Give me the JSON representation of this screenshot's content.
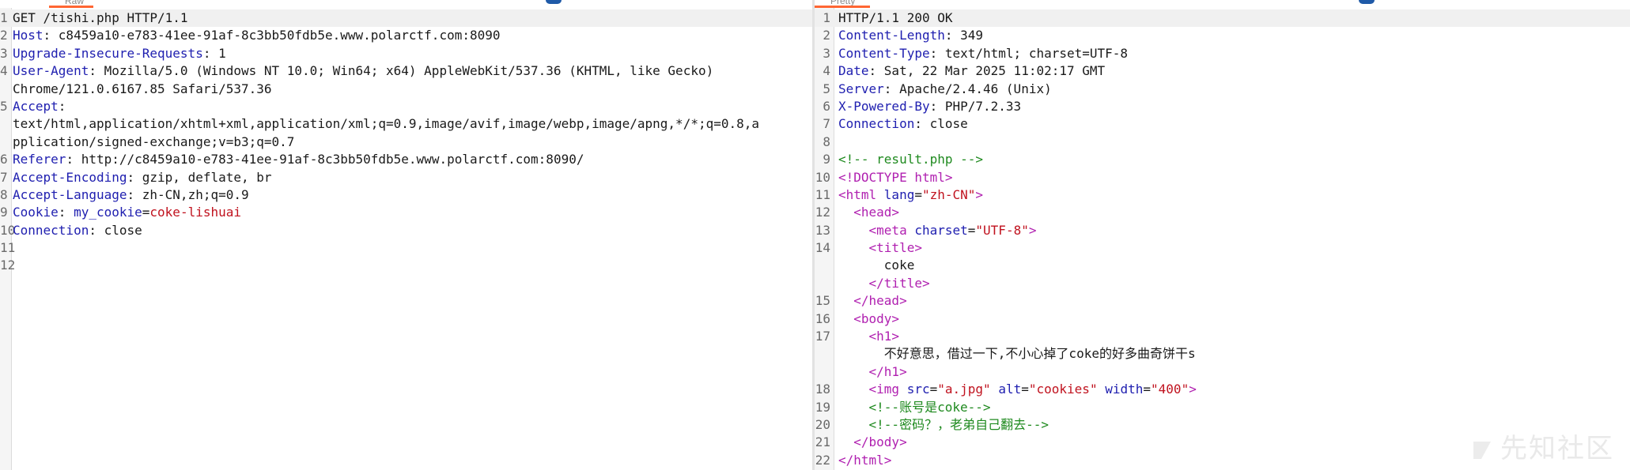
{
  "request": {
    "tab_label": "Raw",
    "lines": [
      {
        "n": "1",
        "cont": false,
        "segs": [
          {
            "t": "GET /tishi.php HTTP/1.1",
            "c": ""
          }
        ]
      },
      {
        "n": "2",
        "cont": false,
        "segs": [
          {
            "t": "Host",
            "c": "hk"
          },
          {
            "t": ": c8459a10-e783-41ee-91af-8c3bb50fdb5e.www.polarctf.com:8090",
            "c": ""
          }
        ]
      },
      {
        "n": "3",
        "cont": false,
        "segs": [
          {
            "t": "Upgrade-Insecure-Requests",
            "c": "hk"
          },
          {
            "t": ": 1",
            "c": ""
          }
        ]
      },
      {
        "n": "4",
        "cont": false,
        "segs": [
          {
            "t": "User-Agent",
            "c": "hk"
          },
          {
            "t": ": Mozilla/5.0 (Windows NT 10.0; Win64; x64) AppleWebKit/537.36 (KHTML, like Gecko)",
            "c": ""
          }
        ]
      },
      {
        "n": "",
        "cont": true,
        "segs": [
          {
            "t": "Chrome/121.0.6167.85 Safari/537.36",
            "c": ""
          }
        ]
      },
      {
        "n": "5",
        "cont": false,
        "segs": [
          {
            "t": "Accept",
            "c": "hk"
          },
          {
            "t": ":",
            "c": ""
          }
        ]
      },
      {
        "n": "",
        "cont": true,
        "segs": [
          {
            "t": "text/html,application/xhtml+xml,application/xml;q=0.9,image/avif,image/webp,image/apng,*/*;q=0.8,a",
            "c": ""
          }
        ]
      },
      {
        "n": "",
        "cont": true,
        "segs": [
          {
            "t": "pplication/signed-exchange;v=b3;q=0.7",
            "c": ""
          }
        ]
      },
      {
        "n": "6",
        "cont": false,
        "segs": [
          {
            "t": "Referer",
            "c": "hk"
          },
          {
            "t": ": http://c8459a10-e783-41ee-91af-8c3bb50fdb5e.www.polarctf.com:8090/",
            "c": ""
          }
        ]
      },
      {
        "n": "7",
        "cont": false,
        "segs": [
          {
            "t": "Accept-Encoding",
            "c": "hk"
          },
          {
            "t": ": gzip, deflate, br",
            "c": ""
          }
        ]
      },
      {
        "n": "8",
        "cont": false,
        "segs": [
          {
            "t": "Accept-Language",
            "c": "hk"
          },
          {
            "t": ": zh-CN,zh;q=0.9",
            "c": ""
          }
        ]
      },
      {
        "n": "9",
        "cont": false,
        "segs": [
          {
            "t": "Cookie",
            "c": "hk"
          },
          {
            "t": ": ",
            "c": ""
          },
          {
            "t": "my_cookie",
            "c": "hk2"
          },
          {
            "t": "=",
            "c": ""
          },
          {
            "t": "coke-lishuai",
            "c": "red"
          }
        ]
      },
      {
        "n": "10",
        "cont": false,
        "segs": [
          {
            "t": "Connection",
            "c": "hk"
          },
          {
            "t": ": close",
            "c": ""
          }
        ]
      },
      {
        "n": "11",
        "cont": false,
        "segs": []
      },
      {
        "n": "12",
        "cont": false,
        "segs": []
      }
    ]
  },
  "response": {
    "tab_label": "Pretty",
    "lines": [
      {
        "n": "1",
        "cont": false,
        "segs": [
          {
            "t": "HTTP/1.1 200 OK",
            "c": ""
          }
        ]
      },
      {
        "n": "2",
        "cont": false,
        "segs": [
          {
            "t": "Content-Length",
            "c": "hk"
          },
          {
            "t": ": 349",
            "c": ""
          }
        ]
      },
      {
        "n": "3",
        "cont": false,
        "segs": [
          {
            "t": "Content-Type",
            "c": "hk"
          },
          {
            "t": ": text/html; charset=UTF-8",
            "c": ""
          }
        ]
      },
      {
        "n": "4",
        "cont": false,
        "segs": [
          {
            "t": "Date",
            "c": "hk"
          },
          {
            "t": ": Sat, 22 Mar 2025 11:02:17 GMT",
            "c": ""
          }
        ]
      },
      {
        "n": "5",
        "cont": false,
        "segs": [
          {
            "t": "Server",
            "c": "hk"
          },
          {
            "t": ": Apache/2.4.46 (Unix)",
            "c": ""
          }
        ]
      },
      {
        "n": "6",
        "cont": false,
        "segs": [
          {
            "t": "X-Powered-By",
            "c": "hk"
          },
          {
            "t": ": PHP/7.2.33",
            "c": ""
          }
        ]
      },
      {
        "n": "7",
        "cont": false,
        "segs": [
          {
            "t": "Connection",
            "c": "hk"
          },
          {
            "t": ": close",
            "c": ""
          }
        ]
      },
      {
        "n": "8",
        "cont": false,
        "segs": []
      },
      {
        "n": "9",
        "cont": false,
        "segs": [
          {
            "t": "<!-- result.php -->",
            "c": "cm"
          }
        ]
      },
      {
        "n": "10",
        "cont": false,
        "segs": [
          {
            "t": "<!DOCTYPE html>",
            "c": "tg"
          }
        ]
      },
      {
        "n": "11",
        "cont": false,
        "segs": [
          {
            "t": "<html ",
            "c": "tg"
          },
          {
            "t": "lang",
            "c": "at"
          },
          {
            "t": "=",
            "c": ""
          },
          {
            "t": "\"zh-CN\"",
            "c": "sv"
          },
          {
            "t": ">",
            "c": "tg"
          }
        ]
      },
      {
        "n": "12",
        "cont": false,
        "segs": [
          {
            "t": "  <head>",
            "c": "tg"
          }
        ]
      },
      {
        "n": "13",
        "cont": false,
        "segs": [
          {
            "t": "    <meta ",
            "c": "tg"
          },
          {
            "t": "charset",
            "c": "at"
          },
          {
            "t": "=",
            "c": ""
          },
          {
            "t": "\"UTF-8\"",
            "c": "sv"
          },
          {
            "t": ">",
            "c": "tg"
          }
        ]
      },
      {
        "n": "14",
        "cont": false,
        "segs": [
          {
            "t": "    <title>",
            "c": "tg"
          }
        ]
      },
      {
        "n": "",
        "cont": true,
        "segs": [
          {
            "t": "      coke",
            "c": ""
          }
        ]
      },
      {
        "n": "",
        "cont": true,
        "segs": [
          {
            "t": "    </title>",
            "c": "tg"
          }
        ]
      },
      {
        "n": "15",
        "cont": false,
        "segs": [
          {
            "t": "  </head>",
            "c": "tg"
          }
        ]
      },
      {
        "n": "16",
        "cont": false,
        "segs": [
          {
            "t": "  <body>",
            "c": "tg"
          }
        ]
      },
      {
        "n": "17",
        "cont": false,
        "segs": [
          {
            "t": "    <h1>",
            "c": "tg"
          }
        ]
      },
      {
        "n": "",
        "cont": true,
        "segs": [
          {
            "t": "      不好意思，借过一下,不小心掉了coke的好多曲奇饼干s",
            "c": ""
          }
        ]
      },
      {
        "n": "",
        "cont": true,
        "segs": [
          {
            "t": "    </h1>",
            "c": "tg"
          }
        ]
      },
      {
        "n": "18",
        "cont": false,
        "segs": [
          {
            "t": "    <img ",
            "c": "tg"
          },
          {
            "t": "src",
            "c": "at"
          },
          {
            "t": "=",
            "c": ""
          },
          {
            "t": "\"a.jpg\"",
            "c": "sv"
          },
          {
            "t": " ",
            "c": ""
          },
          {
            "t": "alt",
            "c": "at"
          },
          {
            "t": "=",
            "c": ""
          },
          {
            "t": "\"cookies\"",
            "c": "sv"
          },
          {
            "t": " ",
            "c": ""
          },
          {
            "t": "width",
            "c": "at"
          },
          {
            "t": "=",
            "c": ""
          },
          {
            "t": "\"400\"",
            "c": "sv"
          },
          {
            "t": ">",
            "c": "tg"
          }
        ]
      },
      {
        "n": "19",
        "cont": false,
        "segs": [
          {
            "t": "    <!--账号是coke-->",
            "c": "cm"
          }
        ]
      },
      {
        "n": "20",
        "cont": false,
        "segs": [
          {
            "t": "    <!--密码？，老弟自己翻去-->",
            "c": "cm"
          }
        ]
      },
      {
        "n": "21",
        "cont": false,
        "segs": [
          {
            "t": "  </body>",
            "c": "tg"
          }
        ]
      },
      {
        "n": "22",
        "cont": false,
        "segs": [
          {
            "t": "</html>",
            "c": "tg"
          }
        ]
      }
    ]
  },
  "watermark": "先知社区"
}
